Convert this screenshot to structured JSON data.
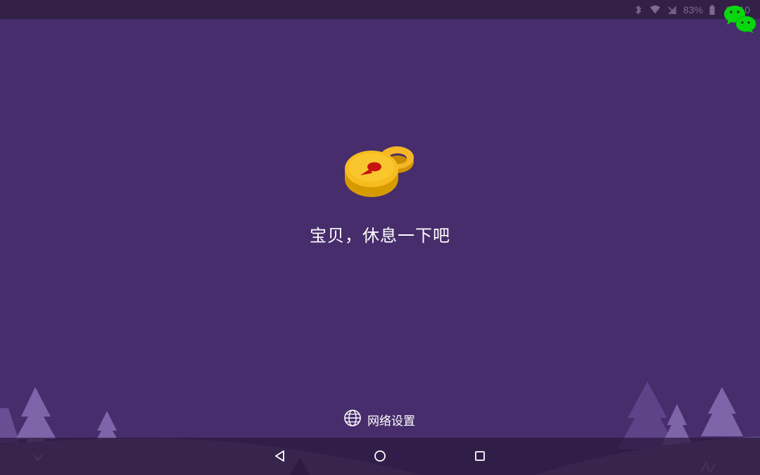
{
  "status_bar": {
    "battery_text": "83%",
    "time": "16:10",
    "icons": [
      "bluetooth-icon",
      "wifi-icon",
      "signal-icon",
      "battery-icon"
    ]
  },
  "overlay": {
    "icon": "wechat-icon",
    "color": "#09d60f"
  },
  "main": {
    "lock_icon": "padlock-icon",
    "message": "宝贝，休息一下吧"
  },
  "footer": {
    "network_settings_label": "网络设置",
    "network_icon": "globe-icon"
  },
  "nav_bar": {
    "buttons": [
      "back-button",
      "home-button",
      "recents-button"
    ]
  },
  "colors": {
    "background": "#472d6b",
    "status_bar": "#332046",
    "lock_gold": "#f4b31a",
    "keyhole": "#c6130f",
    "tree": "#7a5fa3"
  }
}
